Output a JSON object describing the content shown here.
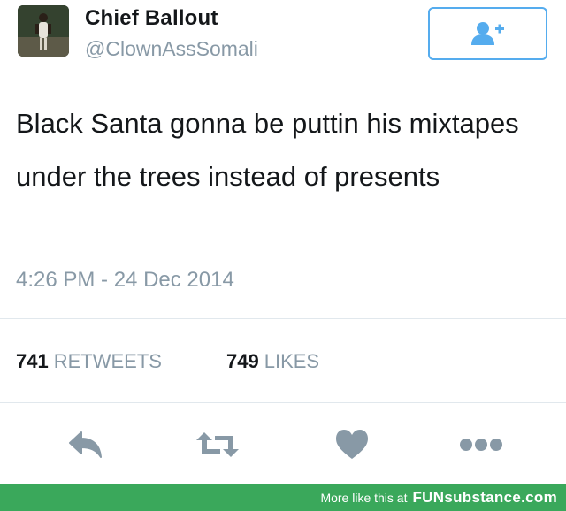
{
  "tweet": {
    "display_name": "Chief Ballout",
    "handle": "@ClownAssSomali",
    "text": "Black Santa gonna be puttin his mixtapes under the trees instead of presents",
    "timestamp": "4:26 PM - 24 Dec 2014"
  },
  "stats": {
    "retweets_count": "741",
    "retweets_label": "RETWEETS",
    "likes_count": "749",
    "likes_label": "LIKES"
  },
  "icons": {
    "follow": "follow-user-icon",
    "reply": "reply-icon",
    "retweet": "retweet-icon",
    "like": "heart-icon",
    "more": "more-icon"
  },
  "footer": {
    "prefix": "More like this at",
    "brand": "FUNsubstance.com"
  },
  "colors": {
    "accent": "#55acee",
    "muted": "#8899a6",
    "icon": "#8899a6",
    "footer_bg": "#3aa85b"
  }
}
